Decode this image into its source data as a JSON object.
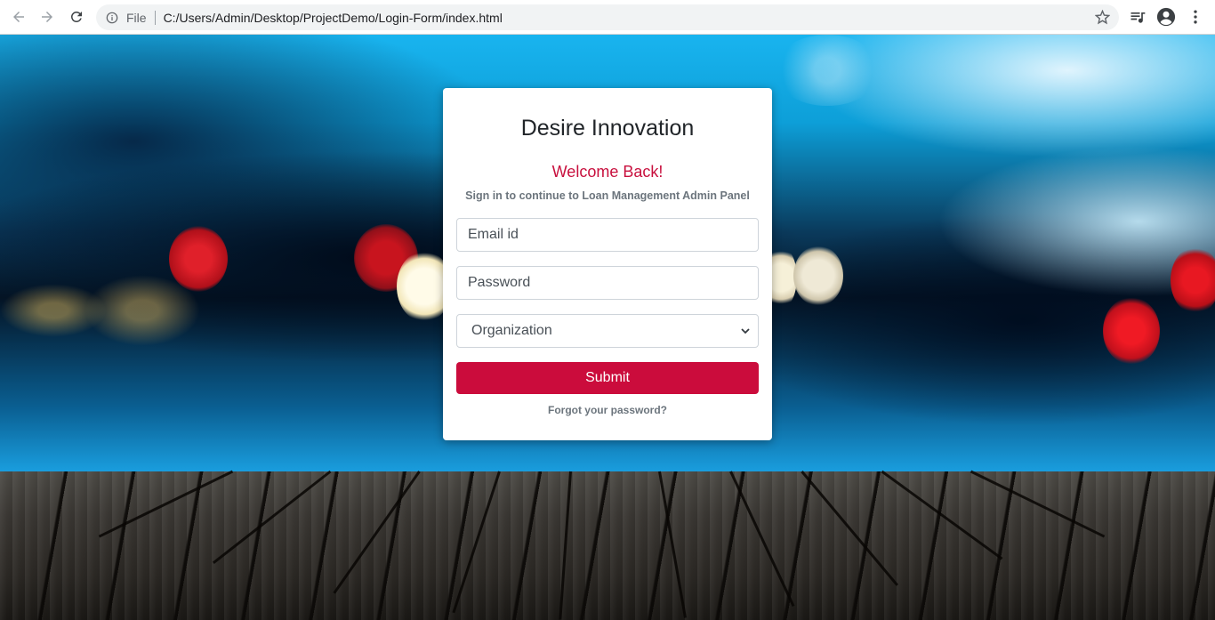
{
  "browser": {
    "scheme_label": "File",
    "url": "C:/Users/Admin/Desktop/ProjectDemo/Login-Form/index.html",
    "icons": [
      "back-icon",
      "forward-icon",
      "reload-icon",
      "info-icon",
      "star-icon",
      "media-control-icon",
      "profile-icon",
      "menu-icon"
    ]
  },
  "login": {
    "brand": "Desire Innovation",
    "welcome": "Welcome Back!",
    "subtitle": "Sign in to continue to Loan Management Admin Panel",
    "email_placeholder": "Email id",
    "password_placeholder": "Password",
    "organization_selected": "Organization",
    "submit_label": "Submit",
    "forgot_label": "Forgot your password?"
  },
  "colors": {
    "accent": "#cb0c3c",
    "welcome_text": "#c8103e"
  }
}
